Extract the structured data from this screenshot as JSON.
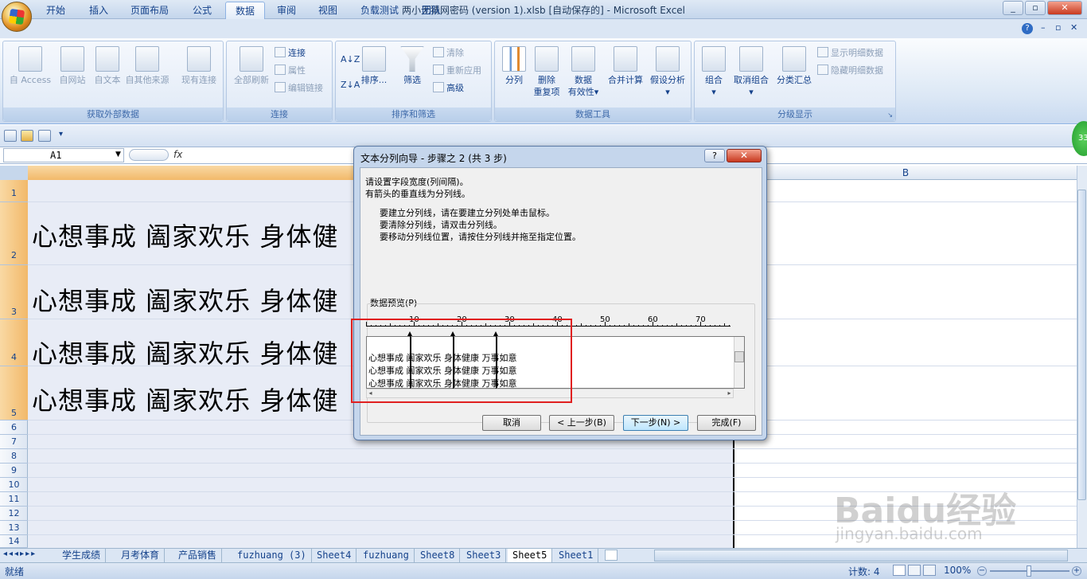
{
  "window": {
    "title": "两小无猜网密码 (version 1).xlsb  [自动保存的] - Microsoft Excel"
  },
  "tabs": [
    "开始",
    "插入",
    "页面布局",
    "公式",
    "数据",
    "审阅",
    "视图",
    "负载测试",
    "团队"
  ],
  "ribbon": {
    "get_external": {
      "label": "获取外部数据",
      "access": "自 Access",
      "web": "自网站",
      "text": "自文本",
      "other": "自其他来源",
      "existing": "现有连接"
    },
    "connections": {
      "label": "连接",
      "refresh_all": "全部刷新",
      "connections": "连接",
      "properties": "属性",
      "edit_links": "编辑链接"
    },
    "sort_filter": {
      "label": "排序和筛选",
      "sort": "排序...",
      "filter": "筛选",
      "clear": "清除",
      "reapply": "重新应用",
      "advanced": "高级"
    },
    "data_tools": {
      "label": "数据工具",
      "text_to_columns": "分列",
      "remove_dup_1": "删除",
      "remove_dup_2": "重复项",
      "validation_1": "数据",
      "validation_2": "有效性",
      "consolidate": "合并计算",
      "what_if": "假设分析"
    },
    "outline": {
      "label": "分级显示",
      "group": "组合",
      "ungroup": "取消组合",
      "subtotal": "分类汇总",
      "show_detail": "显示明细数据",
      "hide_detail": "隐藏明细数据"
    }
  },
  "formula_bar": {
    "name_box": "A1",
    "fx": "fx",
    "content": ""
  },
  "columns": {
    "b": "B"
  },
  "rows": [
    "1",
    "2",
    "3",
    "4",
    "5",
    "6",
    "7",
    "8",
    "9",
    "10",
    "11",
    "12",
    "13",
    "14"
  ],
  "cells": {
    "row_text": "心想事成 阖家欢乐 身体健康 万事如意",
    "row_text_visible": "心想事成  阖家欢乐  身体健"
  },
  "dialog": {
    "title": "文本分列向导 - 步骤之 2 (共 3 步)",
    "help": "?",
    "close": "✕",
    "intro_1": "请设置字段宽度(列间隔)。",
    "intro_2": "有箭头的垂直线为分列线。",
    "tip_1": "要建立分列线，请在要建立分列处单击鼠标。",
    "tip_2": "要清除分列线，请双击分列线。",
    "tip_3": "要移动分列线位置，请按住分列线并拖至指定位置。",
    "preview_label": "数据预览(P)",
    "ruler": [
      "10",
      "20",
      "30",
      "40",
      "50",
      "60",
      "70"
    ],
    "preview_rows": [
      [
        "心想事成",
        "阖家欢乐",
        "身体健康",
        "万事如意"
      ],
      [
        "心想事成",
        "阖家欢乐",
        "身体健康",
        "万事如意"
      ],
      [
        "心想事成",
        "阖家欢乐",
        "身体健康",
        "万事如意"
      ]
    ],
    "buttons": {
      "cancel": "取消",
      "back": "< 上一步(B)",
      "next": "下一步(N) >",
      "finish": "完成(F)"
    }
  },
  "sheets": [
    "学生成绩",
    "月考体育",
    "产品销售",
    "fuzhuang (3)",
    "Sheet4",
    "fuzhuang",
    "Sheet8",
    "Sheet3",
    "Sheet5",
    "Sheet1"
  ],
  "active_sheet": "Sheet5",
  "status": {
    "ready": "就绪",
    "count": "计数: 4",
    "zoom": "100%"
  },
  "badge": "33",
  "watermark": {
    "brand": "Baidu经验",
    "url": "jingyan.baidu.com"
  }
}
